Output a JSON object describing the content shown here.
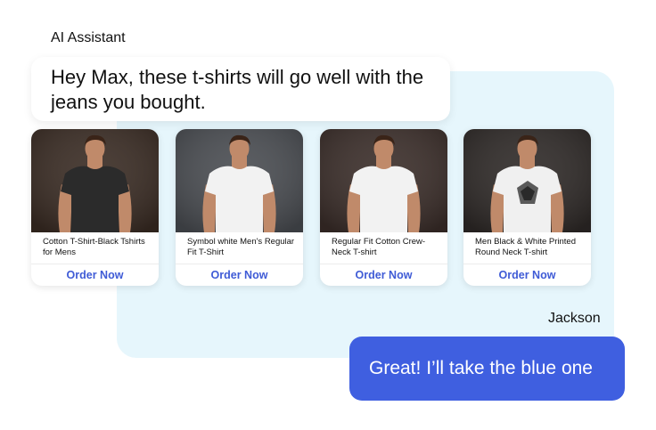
{
  "chat": {
    "ai_sender": "AI Assistant",
    "ai_message": "Hey Max, these t-shirts will go well  with the jeans you bought.",
    "user_sender": "Jackson",
    "user_message": "Great! I’ll take the blue one"
  },
  "products": [
    {
      "title": "Cotton T-Shirt-Black Tshirts for Mens",
      "button": "Order Now",
      "shirt_color": "#2b2b2b",
      "bg_color": "#3a2c24",
      "graphic": false
    },
    {
      "title": "Symbol white Men's Regular Fit T-Shirt",
      "button": "Order Now",
      "shirt_color": "#f2f2f2",
      "bg_color": "#4a4d52",
      "graphic": false
    },
    {
      "title": "Regular Fit Cotton Crew-Neck T-shirt",
      "button": "Order Now",
      "shirt_color": "#f2f2f2",
      "bg_color": "#3b2e2a",
      "graphic": false
    },
    {
      "title": "Men Black & White Printed Round Neck T-shirt",
      "button": "Order Now",
      "shirt_color": "#f0f0f0",
      "bg_color": "#2f2a28",
      "graphic": true
    }
  ],
  "colors": {
    "accent": "#3f5bd6",
    "user_bubble": "#3f5fe0",
    "panel_bg": "#e6f6fc"
  }
}
